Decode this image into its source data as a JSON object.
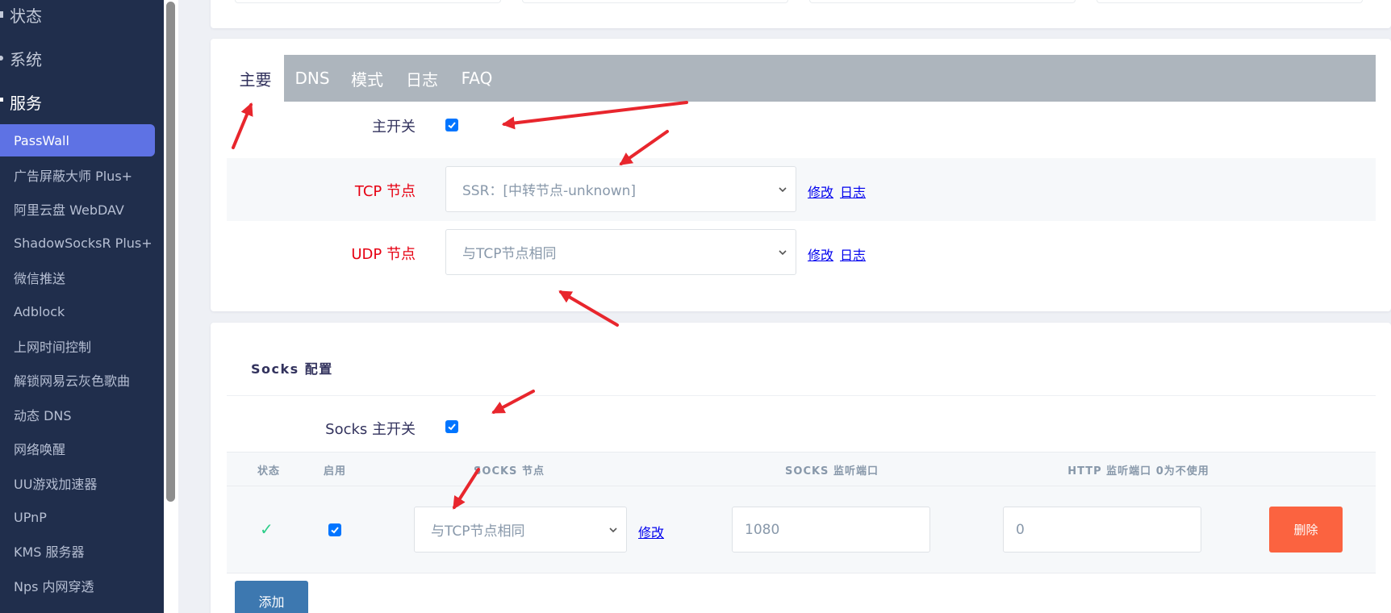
{
  "sidebar": {
    "groups": [
      {
        "label": "状态",
        "icon": "status-icon"
      },
      {
        "label": "系统",
        "icon": "gear-icon"
      },
      {
        "label": "服务",
        "icon": "services-icon"
      }
    ],
    "items": [
      {
        "label": "PassWall",
        "active": true
      },
      {
        "label": "广告屏蔽大师 Plus+"
      },
      {
        "label": "阿里云盘 WebDAV"
      },
      {
        "label": "ShadowSocksR Plus+"
      },
      {
        "label": "微信推送"
      },
      {
        "label": "Adblock"
      },
      {
        "label": "上网时间控制"
      },
      {
        "label": "解锁网易云灰色歌曲"
      },
      {
        "label": "动态 DNS"
      },
      {
        "label": "网络唤醒"
      },
      {
        "label": "UU游戏加速器"
      },
      {
        "label": "UPnP"
      },
      {
        "label": "KMS 服务器"
      },
      {
        "label": "Nps 内网穿透"
      }
    ]
  },
  "tabs": [
    {
      "label": "主要",
      "active": true
    },
    {
      "label": "DNS"
    },
    {
      "label": "模式"
    },
    {
      "label": "日志"
    },
    {
      "label": "FAQ"
    }
  ],
  "main_form": {
    "main_switch": {
      "label": "主开关",
      "checked": true
    },
    "tcp_node": {
      "label": "TCP 节点",
      "value": "SSR：[中转节点-unknown]",
      "edit": "修改",
      "log": "日志"
    },
    "udp_node": {
      "label": "UDP 节点",
      "value": "与TCP节点相同",
      "edit": "修改",
      "log": "日志"
    }
  },
  "socks": {
    "title": "Socks 配置",
    "switch": {
      "label": "Socks 主开关",
      "checked": true
    },
    "headers": [
      "状态",
      "启用",
      "SOCKS 节点",
      "SOCKS 监听端口",
      "HTTP 监听端口 0为不使用"
    ],
    "row": {
      "status": "✓",
      "enabled": true,
      "node": "与TCP节点相同",
      "edit": "修改",
      "socks_port": "1080",
      "http_port": "0",
      "delete": "删除"
    },
    "add_label": "添加"
  },
  "colors": {
    "sidebar_bg": "#202e4c",
    "accent": "#5e72e4",
    "tabbar": "#adb5bd",
    "required_label": "#e60012",
    "delete_button": "#fb6340",
    "add_button": "#3d78b0",
    "annotation_arrow": "#e8262d"
  }
}
